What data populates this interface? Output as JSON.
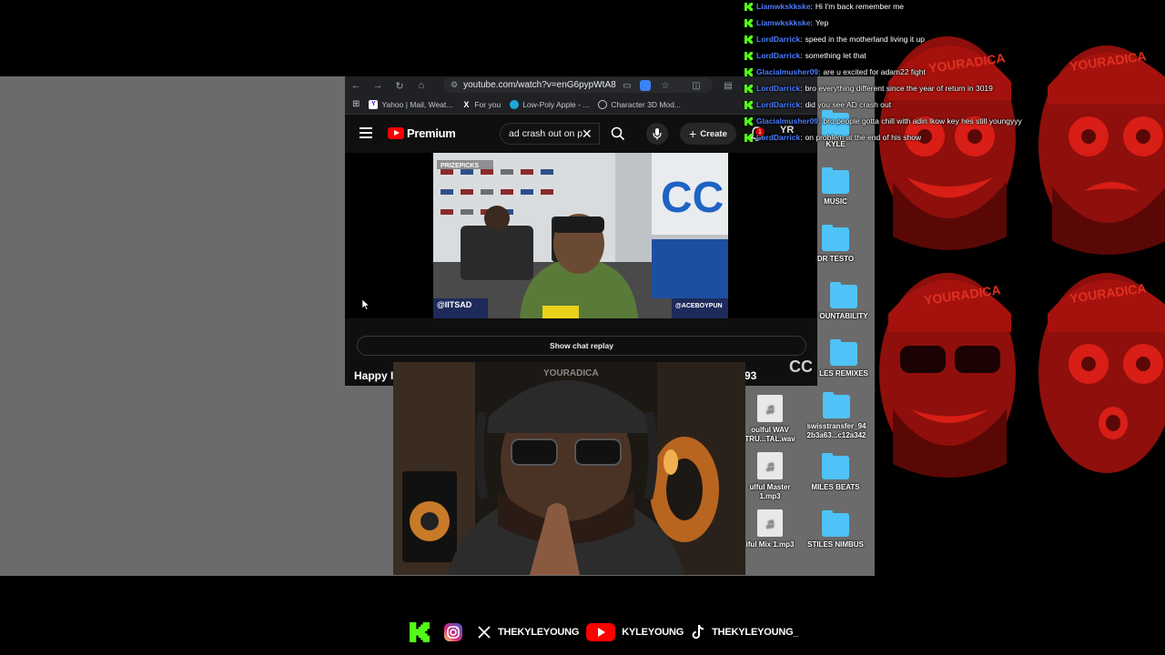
{
  "browser": {
    "url": "youtube.com/watch?v=enG6pypWtA8",
    "bookmarks": [
      {
        "label": "Yahoo | Mail, Weat..."
      },
      {
        "label": "For you"
      },
      {
        "label": "Low-Poly Apple - ..."
      },
      {
        "label": "Character 3D Mod..."
      }
    ]
  },
  "youtube": {
    "logo_text": "Premium",
    "search_value": "ad crash out on p",
    "create_label": "Create",
    "notification_count": "1",
    "avatar_text": "YR",
    "video_overlay": {
      "sponsor": "PRIZEPICKS",
      "left_handle": "@IITSAD",
      "right_handle": "@ACEBOYPUN"
    },
    "show_chat_replay": "Show chat replay",
    "title_start": "Happy I",
    "title_end": "93"
  },
  "webcam": {
    "cap_text": "YOURADICA"
  },
  "wallpaper": {
    "brand": "YOURADICA"
  },
  "desktop_icons": [
    {
      "label": "KYLE",
      "kind": "folder"
    },
    {
      "label": "MUSIC",
      "kind": "folder"
    },
    {
      "label": "DR TESTO",
      "kind": "folder"
    },
    {
      "label": "OUNTABILITY",
      "kind": "folder"
    },
    {
      "label": "LES REMIXES",
      "kind": "folder"
    },
    {
      "label": "swisstransfer_94 2b3a63...c12a342",
      "kind": "folder"
    },
    {
      "label": "MILES BEATS",
      "kind": "folder"
    },
    {
      "label": "STILES NIMBUS",
      "kind": "folder"
    }
  ],
  "desktop_files": [
    {
      "label": "oulful WAV TRU...TAL.wav"
    },
    {
      "label": "ulful Master 1.mp3"
    },
    {
      "label": "iful Mix 1.mp3"
    }
  ],
  "chat": [
    {
      "user": "Liamwkskkske",
      "message": "Hi I'm back remember me"
    },
    {
      "user": "Liamwkskkske",
      "message": "Yep"
    },
    {
      "user": "LordDarrick",
      "message": "speed in the motherland living it up"
    },
    {
      "user": "LordDarrick",
      "message": "something let that"
    },
    {
      "user": "Glacialmusher09",
      "message": "are u excited for adam22 fight"
    },
    {
      "user": "LordDarrick",
      "message": "bro everything different since the year of return in 3019"
    },
    {
      "user": "LordDarrick",
      "message": "did you see AD crash out"
    },
    {
      "user": "Glacialmusher09",
      "message": "bro people gotta chill with adin lkow key hes still youngyyy"
    },
    {
      "user": "LordDarrick",
      "message": "on problem at the end of his show"
    }
  ],
  "socials": [
    {
      "icon": "kick-icon",
      "label": ""
    },
    {
      "icon": "instagram-icon",
      "label": ""
    },
    {
      "icon": "x-icon",
      "label": "THEKYLEYOUNG"
    },
    {
      "icon": "youtube-icon",
      "label": "KYLEYOUNG"
    },
    {
      "icon": "tiktok-icon",
      "label": "THEKYLEYOUNG_"
    }
  ],
  "colors": {
    "kick_green": "#53fc18",
    "chat_username": "#4a7cff",
    "folder_blue": "#4fc3f7",
    "youtube_red": "#ff0000",
    "wallpaper_red": "#b3150f"
  }
}
